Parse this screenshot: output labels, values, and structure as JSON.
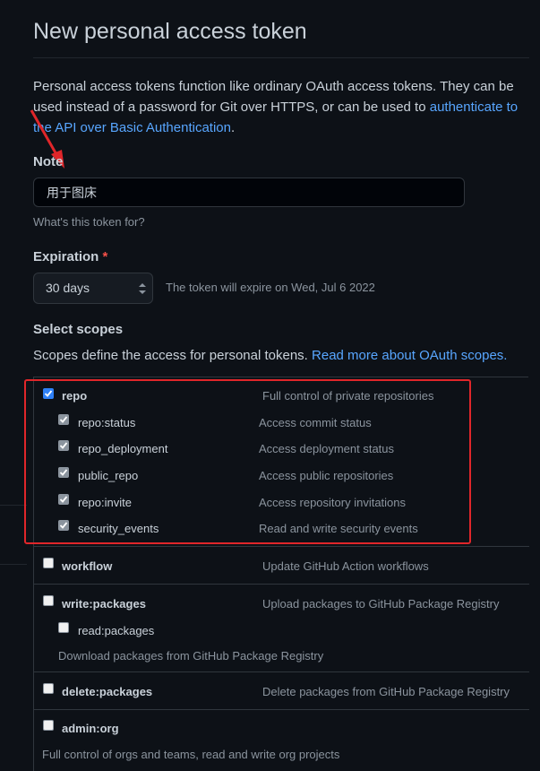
{
  "page": {
    "title": "New personal access token",
    "intro_text": "Personal access tokens function like ordinary OAuth access tokens. They can be used instead of a password for Git over HTTPS, or can be used to ",
    "intro_link": "authenticate to the API over Basic Authentication",
    "intro_end": "."
  },
  "note": {
    "label": "Note",
    "value": "用于图床",
    "hint": "What's this token for?"
  },
  "expiration": {
    "label": "Expiration",
    "required_marker": "*",
    "selected": "30 days",
    "note": "The token will expire on Wed, Jul 6 2022"
  },
  "scopes": {
    "label": "Select scopes",
    "desc": "Scopes define the access for personal tokens. ",
    "desc_link": "Read more about OAuth scopes.",
    "items": [
      {
        "name": "repo",
        "desc": "Full control of private repositories",
        "checked": true
      },
      {
        "name": "repo:status",
        "desc": "Access commit status",
        "checked": true
      },
      {
        "name": "repo_deployment",
        "desc": "Access deployment status",
        "checked": true
      },
      {
        "name": "public_repo",
        "desc": "Access public repositories",
        "checked": true
      },
      {
        "name": "repo:invite",
        "desc": "Access repository invitations",
        "checked": true
      },
      {
        "name": "security_events",
        "desc": "Read and write security events",
        "checked": true
      },
      {
        "name": "workflow",
        "desc": "Update GitHub Action workflows",
        "checked": false
      },
      {
        "name": "write:packages",
        "desc": "Upload packages to GitHub Package Registry",
        "checked": false
      },
      {
        "name": "read:packages",
        "desc": "Download packages from GitHub Package Registry",
        "checked": false
      },
      {
        "name": "delete:packages",
        "desc": "Delete packages from GitHub Package Registry",
        "checked": false
      },
      {
        "name": "admin:org",
        "desc": "Full control of orgs and teams, read and write org projects",
        "checked": false
      }
    ]
  },
  "colors": {
    "background": "#0d1117",
    "link": "#58a6ff",
    "accent_checkbox": "#2f81f7",
    "annotation_red": "#e0262a"
  }
}
